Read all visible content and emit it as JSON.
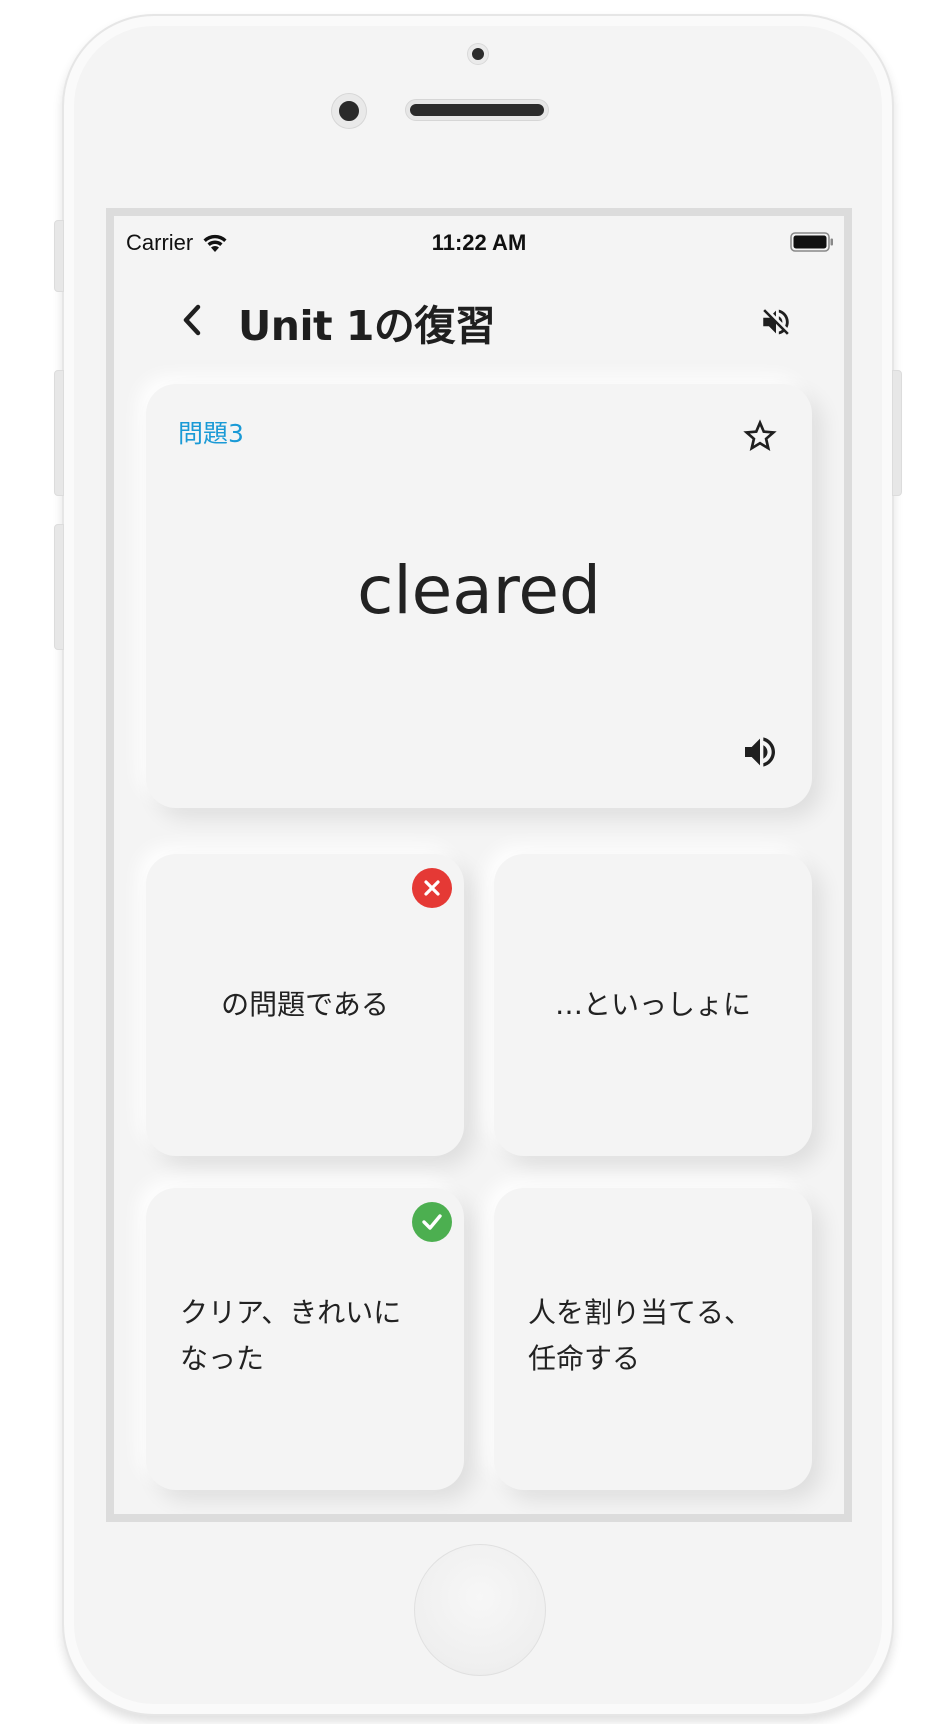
{
  "status_bar": {
    "carrier": "Carrier",
    "time": "11:22 AM",
    "wifi_icon": "wifi-icon",
    "battery_icon": "battery-full-icon"
  },
  "nav": {
    "back_icon": "chevron-left-icon",
    "title": "Unit 1の復習",
    "mute_icon": "volume-off-icon"
  },
  "question": {
    "label": "問題3",
    "word": "cleared",
    "star_icon": "star-outline-icon",
    "speaker_icon": "volume-up-icon",
    "label_color": "#1a9ad6"
  },
  "answers": [
    {
      "text": "の問題である",
      "status": "wrong",
      "status_icon": "close-circle-icon"
    },
    {
      "text": "…といっしょに",
      "status": "none"
    },
    {
      "text": "クリア、きれいに\nなった",
      "status": "correct",
      "status_icon": "check-circle-icon"
    },
    {
      "text": "人を割り当てる、\n任命する",
      "status": "none"
    }
  ],
  "colors": {
    "wrong": "#e53935",
    "correct": "#4caf50",
    "background": "#f4f4f4"
  }
}
